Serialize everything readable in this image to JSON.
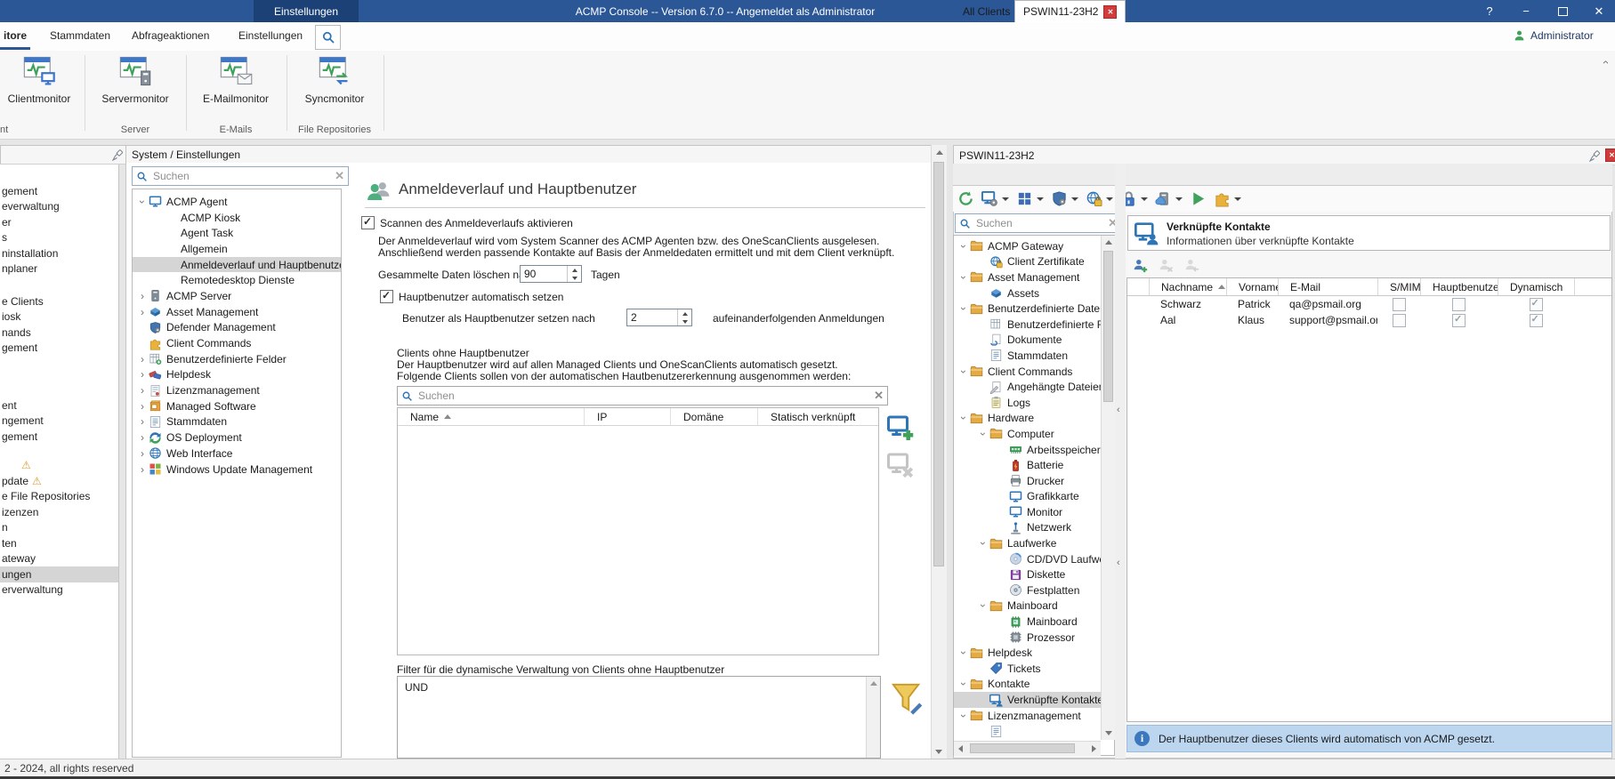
{
  "titlebar": {
    "pill": "Einstellungen",
    "title": "ACMP Console -- Version 6.7.0 -- Angemeldet als Administrator",
    "help": "?"
  },
  "menubar": {
    "tabs": [
      {
        "label": "itore",
        "selected": true
      },
      {
        "label": "Stammdaten"
      },
      {
        "label": "Abfrageaktionen"
      },
      {
        "label": "Einstellungen"
      }
    ],
    "user": "Administrator"
  },
  "ribbon": {
    "buttons": [
      {
        "label": "Clientmonitor",
        "icon": "appwin-client"
      },
      {
        "label": "Servermonitor",
        "icon": "appwin-server"
      },
      {
        "label": "E-Mailmonitor",
        "icon": "appwin-mail"
      },
      {
        "label": "Syncmonitor",
        "icon": "appwin-sync"
      }
    ],
    "groups": [
      {
        "label": "nt"
      },
      {
        "label": "Server"
      },
      {
        "label": "E-Mails"
      },
      {
        "label": "File Repositories"
      }
    ]
  },
  "sidebar": {
    "items": [
      {
        "label": "gement"
      },
      {
        "label": "everwaltung"
      },
      {
        "label": "er"
      },
      {
        "label": "s"
      },
      {
        "label": "ninstallation"
      },
      {
        "label": "nplaner"
      },
      {
        "label": "",
        "cls": "gap-a"
      },
      {
        "label": "e Clients"
      },
      {
        "label": "iosk"
      },
      {
        "label": "nands"
      },
      {
        "label": "gement"
      },
      {
        "label": "",
        "cls": "gap-b"
      },
      {
        "label": "ent"
      },
      {
        "label": "ngement"
      },
      {
        "label": "gement"
      },
      {
        "label": "",
        "cls": "gap-c"
      },
      {
        "label": "",
        "warn": true,
        "cls": "ind"
      },
      {
        "label": "pdate",
        "warn": true
      },
      {
        "label": "e File Repositories"
      },
      {
        "label": "izenzen"
      },
      {
        "label": "n"
      },
      {
        "label": "ten"
      },
      {
        "label": "ateway"
      },
      {
        "label": "ungen",
        "selected": true
      },
      {
        "label": "erverwaltung"
      }
    ]
  },
  "system_panel": {
    "title": "System / Einstellungen",
    "search_placeholder": "Suchen",
    "tree": [
      {
        "label": "ACMP Agent",
        "level": 0,
        "chev": true,
        "open": true,
        "icon": "monitor"
      },
      {
        "label": "ACMP Kiosk",
        "level": 1
      },
      {
        "label": "Agent Task",
        "level": 1
      },
      {
        "label": "Allgemein",
        "level": 1
      },
      {
        "label": "Anmeldeverlauf und Hauptbenutzer",
        "level": 1,
        "selected": true
      },
      {
        "label": "Remotedesktop Dienste",
        "level": 1
      },
      {
        "label": "ACMP Server",
        "level": 0,
        "chev": true,
        "icon": "server"
      },
      {
        "label": "Asset Management",
        "level": 0,
        "chev": true,
        "icon": "asset"
      },
      {
        "label": "Defender Management",
        "level": 0,
        "icon": "shield"
      },
      {
        "label": "Client Commands",
        "level": 0,
        "icon": "puzzle"
      },
      {
        "label": "Benutzerdefinierte Felder",
        "level": 0,
        "chev": true,
        "icon": "table-add"
      },
      {
        "label": "Helpdesk",
        "level": 0,
        "chev": true,
        "icon": "tags"
      },
      {
        "label": "Lizenzmanagement",
        "level": 0,
        "chev": true,
        "icon": "cert"
      },
      {
        "label": "Managed Software",
        "level": 0,
        "chev": true,
        "icon": "software"
      },
      {
        "label": "Stammdaten",
        "level": 0,
        "chev": true,
        "icon": "list"
      },
      {
        "label": "OS Deployment",
        "level": 0,
        "chev": true,
        "icon": "os-deploy"
      },
      {
        "label": "Web Interface",
        "level": 0,
        "chev": true,
        "icon": "web"
      },
      {
        "label": "Windows Update Management",
        "level": 0,
        "chev": true,
        "icon": "win-update"
      }
    ]
  },
  "form": {
    "title": "Anmeldeverlauf und Hauptbenutzer",
    "cb_scan": "Scannen des Anmeldeverlaufs aktivieren",
    "desc1": "Der Anmeldeverlauf wird vom System Scanner des ACMP Agenten bzw. des OneScanClients ausgelesen.",
    "desc2": "Anschließend werden passende Kontakte auf Basis der Anmeldedaten ermittelt und mit dem Client verknüpft.",
    "delete_label": "Gesammelte Daten löschen nach",
    "delete_value": "90",
    "delete_unit": "Tagen",
    "cb_auto": "Hauptbenutzer automatisch setzen",
    "after_label": "Benutzer als Hauptbenutzer setzen nach",
    "after_value": "2",
    "after_unit": "aufeinanderfolgenden Anmeldungen",
    "clients_title": "Clients ohne Hauptbenutzer",
    "clients_desc1": "Der Hauptbenutzer wird auf allen Managed Clients und OneScanClients automatisch gesetzt.",
    "clients_desc2": "Folgende Clients sollen von der automatischen Hautbenutzererkennung ausgenommen werden:",
    "search_placeholder": "Suchen",
    "columns": [
      {
        "label": "Name",
        "sorted": true
      },
      {
        "label": "IP"
      },
      {
        "label": "Domäne"
      },
      {
        "label": "Statisch verknüpft"
      }
    ],
    "filter_label": "Filter für die dynamische Verwaltung von Clients ohne Hauptbenutzer",
    "filter_value": "UND"
  },
  "client_panel": {
    "title": "PSWIN11-23H2",
    "tabs": [
      {
        "label": "All Clients"
      },
      {
        "label": "PSWIN11-23H2",
        "active": true
      }
    ],
    "toolbar": [
      {
        "icon": "refresh"
      },
      {
        "icon": "monitor-gear",
        "dd": true
      },
      {
        "icon": "grid",
        "dd": true
      },
      {
        "icon": "shield-gear",
        "dd": true
      },
      {
        "icon": "globe-lock",
        "dd": true
      },
      {
        "icon": "lock",
        "dd": true
      },
      {
        "icon": "server-cloud",
        "dd": true
      },
      {
        "icon": "play"
      },
      {
        "icon": "puzzle",
        "dd": true
      }
    ],
    "search_placeholder": "Suchen",
    "tree": [
      {
        "label": "ACMP Gateway",
        "level": 0,
        "chev": true,
        "open": true,
        "icon": "folder"
      },
      {
        "label": "Client Zertifikate",
        "level": 1,
        "icon": "globe-lock"
      },
      {
        "label": "Asset Management",
        "level": 0,
        "chev": true,
        "open": true,
        "icon": "folder"
      },
      {
        "label": "Assets",
        "level": 1,
        "icon": "asset"
      },
      {
        "label": "Benutzerdefinierte Daten",
        "level": 0,
        "chev": true,
        "open": true,
        "icon": "folder"
      },
      {
        "label": "Benutzerdefinierte Felder",
        "level": 1,
        "icon": "table"
      },
      {
        "label": "Dokumente",
        "level": 1,
        "icon": "doc-link"
      },
      {
        "label": "Stammdaten",
        "level": 1,
        "icon": "list"
      },
      {
        "label": "Client Commands",
        "level": 0,
        "chev": true,
        "open": true,
        "icon": "folder"
      },
      {
        "label": "Angehängte Dateien",
        "level": 1,
        "icon": "doc-clip"
      },
      {
        "label": "Logs",
        "level": 1,
        "icon": "clipboard"
      },
      {
        "label": "Hardware",
        "level": 0,
        "chev": true,
        "open": true,
        "icon": "folder"
      },
      {
        "label": "Computer",
        "level": 1,
        "chev": true,
        "open": true,
        "icon": "folder"
      },
      {
        "label": "Arbeitsspeicher",
        "level": 2,
        "icon": "ram"
      },
      {
        "label": "Batterie",
        "level": 2,
        "icon": "battery"
      },
      {
        "label": "Drucker",
        "level": 2,
        "icon": "printer"
      },
      {
        "label": "Grafikkarte",
        "level": 2,
        "icon": "monitor"
      },
      {
        "label": "Monitor",
        "level": 2,
        "icon": "monitor"
      },
      {
        "label": "Netzwerk",
        "level": 2,
        "icon": "network"
      },
      {
        "label": "Laufwerke",
        "level": 1,
        "chev": true,
        "open": true,
        "icon": "folder"
      },
      {
        "label": "CD/DVD Laufwerke",
        "level": 2,
        "icon": "cd"
      },
      {
        "label": "Diskette",
        "level": 2,
        "icon": "floppy"
      },
      {
        "label": "Festplatten",
        "level": 2,
        "icon": "hdd"
      },
      {
        "label": "Mainboard",
        "level": 1,
        "chev": true,
        "open": true,
        "icon": "folder"
      },
      {
        "label": "Mainboard",
        "level": 2,
        "icon": "chip"
      },
      {
        "label": "Prozessor",
        "level": 2,
        "icon": "cpu"
      },
      {
        "label": "Helpdesk",
        "level": 0,
        "chev": true,
        "open": true,
        "icon": "folder"
      },
      {
        "label": "Tickets",
        "level": 1,
        "icon": "tag"
      },
      {
        "label": "Kontakte",
        "level": 0,
        "chev": true,
        "open": true,
        "icon": "folder"
      },
      {
        "label": "Verknüpfte Kontakte",
        "level": 1,
        "icon": "monitor-person",
        "selected": true
      },
      {
        "label": "Lizenzmanagement",
        "level": 0,
        "chev": true,
        "open": true,
        "icon": "folder"
      },
      {
        "label": "",
        "level": 1,
        "icon": "list"
      }
    ],
    "contacts": {
      "title": "Verknüpfte Kontakte",
      "subtitle": "Informationen über verknüpfte Kontakte",
      "toolbar": [
        {
          "icon": "person-add",
          "enabled": true
        },
        {
          "icon": "person-x"
        },
        {
          "icon": "person-return"
        }
      ],
      "columns": [
        {
          "label": "Nachname",
          "sorted": true
        },
        {
          "label": "Vorname"
        },
        {
          "label": "E-Mail"
        },
        {
          "label": "S/MIME"
        },
        {
          "label": "Hauptbenutzer"
        },
        {
          "label": "Dynamisch"
        }
      ],
      "rows": [
        {
          "nachname": "Schwarz",
          "vorname": "Patrick",
          "email": "qa@psmail.org",
          "smime": false,
          "haupt": false,
          "dyn": true
        },
        {
          "nachname": "Aal",
          "vorname": "Klaus",
          "email": "support@psmail.org",
          "smime": false,
          "haupt": true,
          "dyn": true
        }
      ],
      "info": "Der Hauptbenutzer dieses Clients wird automatisch von ACMP gesetzt."
    }
  },
  "statusbar": {
    "text": "2 - 2024, all rights reserved"
  },
  "colors": {
    "titlebar": "#2B5797",
    "titlebar_pill": "#1C4176",
    "accent_blue": "#2E75B6",
    "accent_green": "#3FA25A",
    "folder_yellow": "#E5AA41",
    "selection_gray": "#D5D5D5",
    "info_bar": "#BCD6F0",
    "close_badge_red": "#D23B3B"
  }
}
